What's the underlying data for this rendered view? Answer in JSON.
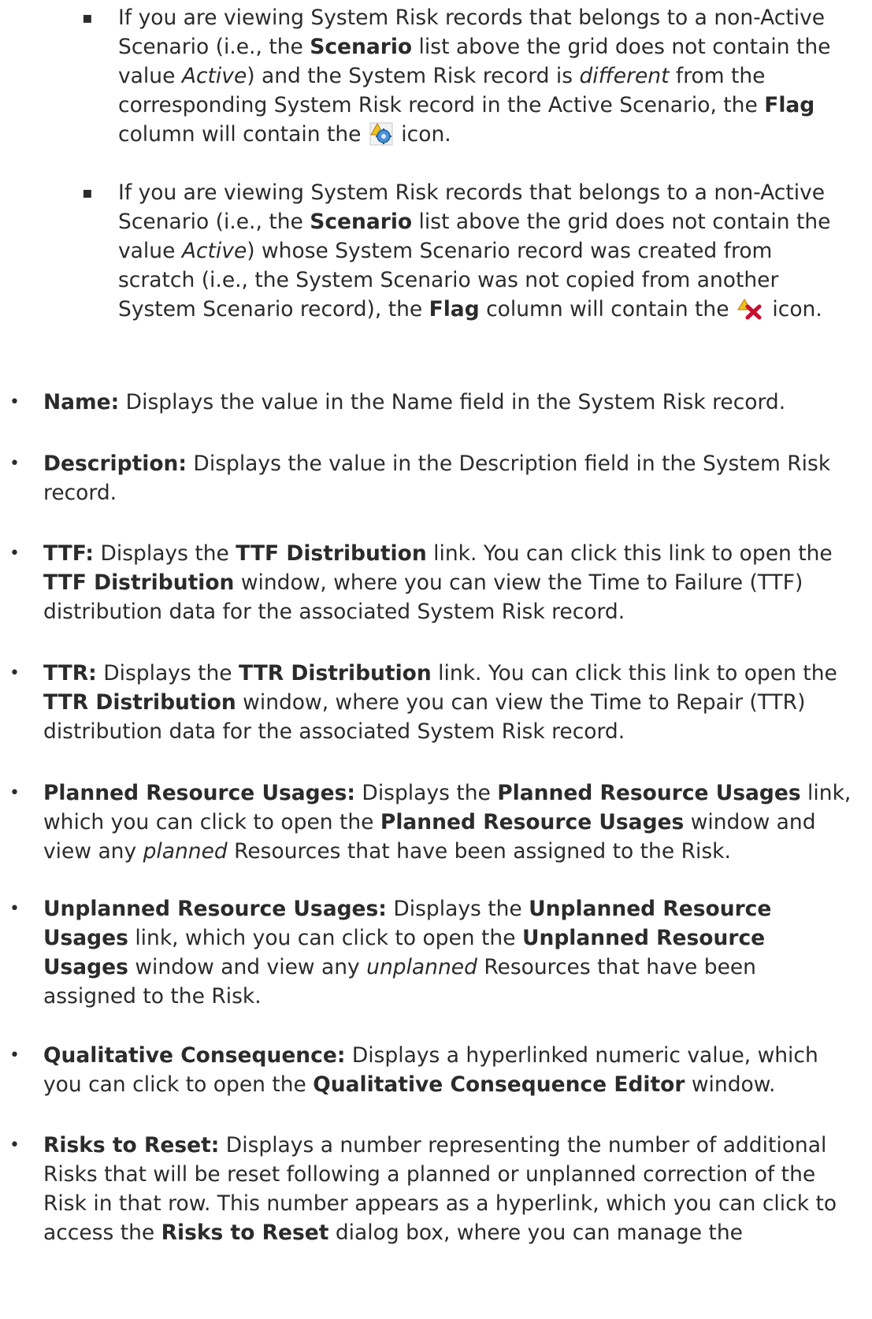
{
  "sub_items": [
    {
      "t1": "If you are viewing System Risk records that belongs to a non-Active Scenario (i.e., the ",
      "b1": "Scenario",
      "t2": " list above the grid does not contain the value ",
      "i1": "Active",
      "t3": ") and the System Risk record is ",
      "i2": "different",
      "t4": " from the corresponding System Risk record in the Active Scenario, the ",
      "b2": "Flag",
      "t5": " column will contain the ",
      "icon": "gear-warning-icon",
      "t6": " icon."
    },
    {
      "t1": "If you are viewing System Risk records that belongs to a non-Active Scenario (i.e., the ",
      "b1": "Scenario",
      "t2": " list above the grid does not contain the value ",
      "i1": "Active",
      "t3": ") whose System Scenario record was created from scratch (i.e., the System Scenario was not copied from another System Scenario record), the ",
      "b2": "Flag",
      "t4": " column will contain the ",
      "icon": "warning-x-icon",
      "t5": "  icon."
    }
  ],
  "items": [
    {
      "name": "name",
      "segments": [
        {
          "text": "Name:",
          "style": "b"
        },
        {
          "text": " Displays the value in the Name field in the System Risk record.",
          "style": ""
        }
      ]
    },
    {
      "name": "description",
      "segments": [
        {
          "text": "Description:",
          "style": "b"
        },
        {
          "text": " Displays the value in the Description field in the System Risk record.",
          "style": ""
        }
      ]
    },
    {
      "name": "ttf",
      "segments": [
        {
          "text": "TTF:",
          "style": "b"
        },
        {
          "text": " Displays the ",
          "style": ""
        },
        {
          "text": "TTF Distribution",
          "style": "b"
        },
        {
          "text": " link. You can click this link to open the ",
          "style": ""
        },
        {
          "text": "TTF Distribution",
          "style": "b"
        },
        {
          "text": " window, where you can view the Time to Failure (TTF) distribution data for the associated System Risk record.",
          "style": ""
        }
      ]
    },
    {
      "name": "ttr",
      "segments": [
        {
          "text": "TTR:",
          "style": "b"
        },
        {
          "text": " Displays the ",
          "style": ""
        },
        {
          "text": "TTR Distribution",
          "style": "b"
        },
        {
          "text": " link. You can click this link to open the ",
          "style": ""
        },
        {
          "text": "TTR Distribution",
          "style": "b"
        },
        {
          "text": " window, where you can view the Time to Repair (TTR) distribution data for the associated System Risk record.",
          "style": ""
        }
      ]
    },
    {
      "name": "planned-resource-usages",
      "segments": [
        {
          "text": "Planned Resource Usages:",
          "style": "b"
        },
        {
          "text": " Displays the ",
          "style": ""
        },
        {
          "text": "Planned Resource Usages",
          "style": "b"
        },
        {
          "text": " link, which you can click to open the ",
          "style": ""
        },
        {
          "text": "Planned Resource Usages",
          "style": "b"
        },
        {
          "text": " window and view any ",
          "style": ""
        },
        {
          "text": "planned",
          "style": "i"
        },
        {
          "text": " Resources that have been assigned to the Risk.",
          "style": ""
        }
      ]
    },
    {
      "name": "unplanned-resource-usages",
      "segments": [
        {
          "text": "Unplanned Resource Usages:",
          "style": "b"
        },
        {
          "text": " Displays the ",
          "style": ""
        },
        {
          "text": "Unplanned Resource Usages",
          "style": "b"
        },
        {
          "text": " link, which you can click to open the ",
          "style": ""
        },
        {
          "text": "Unplanned Resource Usages",
          "style": "b"
        },
        {
          "text": " window and view any ",
          "style": ""
        },
        {
          "text": "unplanned",
          "style": "i"
        },
        {
          "text": " Resources that have been assigned to the Risk.",
          "style": ""
        }
      ]
    },
    {
      "name": "qualitative-consequence",
      "segments": [
        {
          "text": "Qualitative Consequence:",
          "style": "b"
        },
        {
          "text": " Displays a hyperlinked numeric value, which you can click to open the ",
          "style": ""
        },
        {
          "text": "Qualitative Consequence Editor",
          "style": "b"
        },
        {
          "text": " window.",
          "style": ""
        }
      ]
    },
    {
      "name": "risks-to-reset",
      "segments": [
        {
          "text": "Risks to Reset:",
          "style": "b"
        },
        {
          "text": " Displays a number representing the number of additional Risks that will be reset following a planned or unplanned correction of the Risk in that row. This number appears as a hyperlink, which you can click to access the ",
          "style": ""
        },
        {
          "text": "Risks to Reset",
          "style": "b"
        },
        {
          "text": " dialog box, where you can manage the",
          "style": ""
        }
      ]
    }
  ]
}
